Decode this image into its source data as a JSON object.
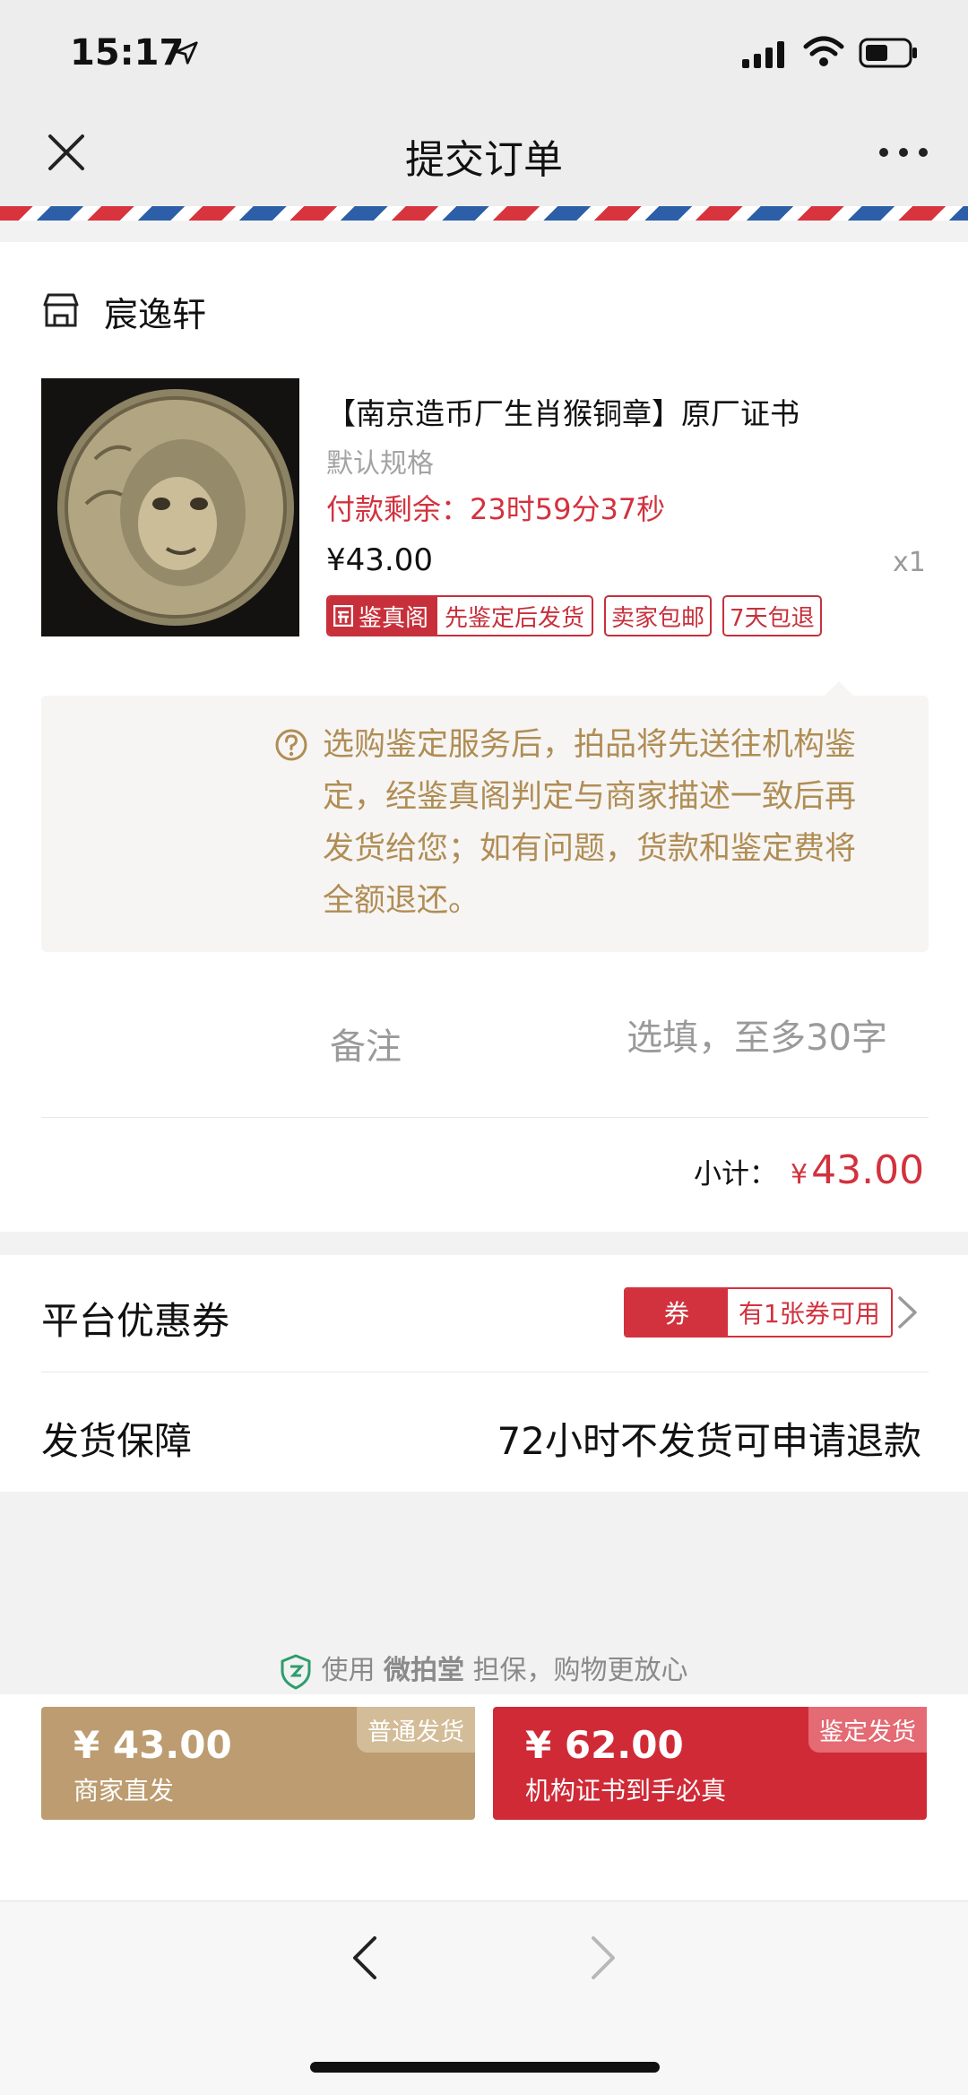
{
  "status_bar": {
    "time": "15:17"
  },
  "nav": {
    "title": "提交订单"
  },
  "store": {
    "name": "宸逸轩"
  },
  "product": {
    "title": "【南京造币厂生肖猴铜章】原厂证书",
    "spec": "默认规格",
    "countdown": "付款剩余：23时59分37秒",
    "price": "¥43.00",
    "quantity": "x1",
    "tags": {
      "auth_brand": "鉴真阁",
      "auth_desc": "先鉴定后发货",
      "free_shipping": "卖家包邮",
      "return_policy": "7天包退"
    }
  },
  "notice": {
    "text": "选购鉴定服务后，拍品将先送往机构鉴定，经鉴真阁判定与商家描述一致后再发货给您；如有问题，货款和鉴定费将全额退还。"
  },
  "memo": {
    "label": "备注",
    "placeholder": "选填，至多30字"
  },
  "subtotal": {
    "label": "小计：",
    "currency": "¥",
    "amount": "43.00"
  },
  "coupon": {
    "label": "平台优惠券",
    "badge_left": "券",
    "badge_right": "有1张券可用"
  },
  "shipping": {
    "label": "发货保障",
    "value": "72小时不发货可申请退款"
  },
  "guarantee": {
    "prefix": "使用",
    "brand": "微拍堂",
    "suffix": "担保，购物更放心"
  },
  "actions": {
    "normal": {
      "price": "¥ 43.00",
      "subtitle": "商家直发",
      "corner": "普通发货"
    },
    "auth": {
      "price": "¥ 62.00",
      "subtitle": "机构证书到手必真",
      "corner": "鉴定发货"
    }
  },
  "colors": {
    "accent_red": "#d2323e",
    "gold": "#bc9c70",
    "notice_text": "#b08d55"
  },
  "icons": [
    "location-arrow-icon",
    "signal-icon",
    "wifi-icon",
    "battery-icon",
    "close-icon",
    "more-icon",
    "store-icon",
    "question-icon",
    "chevron-right-icon",
    "shield-icon",
    "back-arrow-icon",
    "forward-arrow-icon"
  ]
}
